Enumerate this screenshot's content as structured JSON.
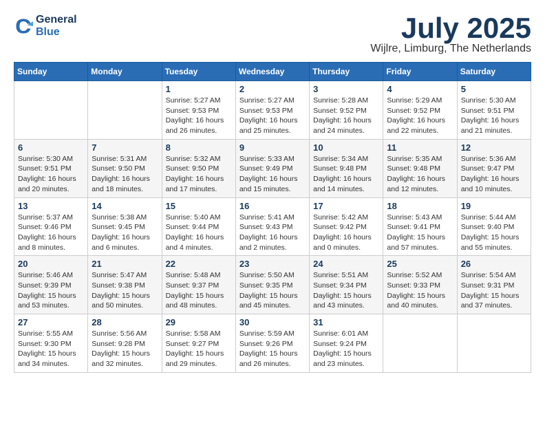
{
  "logo": {
    "line1": "General",
    "line2": "Blue"
  },
  "title": "July 2025",
  "location": "Wijlre, Limburg, The Netherlands",
  "weekdays": [
    "Sunday",
    "Monday",
    "Tuesday",
    "Wednesday",
    "Thursday",
    "Friday",
    "Saturday"
  ],
  "weeks": [
    [
      {
        "day": "",
        "text": ""
      },
      {
        "day": "",
        "text": ""
      },
      {
        "day": "1",
        "text": "Sunrise: 5:27 AM\nSunset: 9:53 PM\nDaylight: 16 hours and 26 minutes."
      },
      {
        "day": "2",
        "text": "Sunrise: 5:27 AM\nSunset: 9:53 PM\nDaylight: 16 hours and 25 minutes."
      },
      {
        "day": "3",
        "text": "Sunrise: 5:28 AM\nSunset: 9:52 PM\nDaylight: 16 hours and 24 minutes."
      },
      {
        "day": "4",
        "text": "Sunrise: 5:29 AM\nSunset: 9:52 PM\nDaylight: 16 hours and 22 minutes."
      },
      {
        "day": "5",
        "text": "Sunrise: 5:30 AM\nSunset: 9:51 PM\nDaylight: 16 hours and 21 minutes."
      }
    ],
    [
      {
        "day": "6",
        "text": "Sunrise: 5:30 AM\nSunset: 9:51 PM\nDaylight: 16 hours and 20 minutes."
      },
      {
        "day": "7",
        "text": "Sunrise: 5:31 AM\nSunset: 9:50 PM\nDaylight: 16 hours and 18 minutes."
      },
      {
        "day": "8",
        "text": "Sunrise: 5:32 AM\nSunset: 9:50 PM\nDaylight: 16 hours and 17 minutes."
      },
      {
        "day": "9",
        "text": "Sunrise: 5:33 AM\nSunset: 9:49 PM\nDaylight: 16 hours and 15 minutes."
      },
      {
        "day": "10",
        "text": "Sunrise: 5:34 AM\nSunset: 9:48 PM\nDaylight: 16 hours and 14 minutes."
      },
      {
        "day": "11",
        "text": "Sunrise: 5:35 AM\nSunset: 9:48 PM\nDaylight: 16 hours and 12 minutes."
      },
      {
        "day": "12",
        "text": "Sunrise: 5:36 AM\nSunset: 9:47 PM\nDaylight: 16 hours and 10 minutes."
      }
    ],
    [
      {
        "day": "13",
        "text": "Sunrise: 5:37 AM\nSunset: 9:46 PM\nDaylight: 16 hours and 8 minutes."
      },
      {
        "day": "14",
        "text": "Sunrise: 5:38 AM\nSunset: 9:45 PM\nDaylight: 16 hours and 6 minutes."
      },
      {
        "day": "15",
        "text": "Sunrise: 5:40 AM\nSunset: 9:44 PM\nDaylight: 16 hours and 4 minutes."
      },
      {
        "day": "16",
        "text": "Sunrise: 5:41 AM\nSunset: 9:43 PM\nDaylight: 16 hours and 2 minutes."
      },
      {
        "day": "17",
        "text": "Sunrise: 5:42 AM\nSunset: 9:42 PM\nDaylight: 16 hours and 0 minutes."
      },
      {
        "day": "18",
        "text": "Sunrise: 5:43 AM\nSunset: 9:41 PM\nDaylight: 15 hours and 57 minutes."
      },
      {
        "day": "19",
        "text": "Sunrise: 5:44 AM\nSunset: 9:40 PM\nDaylight: 15 hours and 55 minutes."
      }
    ],
    [
      {
        "day": "20",
        "text": "Sunrise: 5:46 AM\nSunset: 9:39 PM\nDaylight: 15 hours and 53 minutes."
      },
      {
        "day": "21",
        "text": "Sunrise: 5:47 AM\nSunset: 9:38 PM\nDaylight: 15 hours and 50 minutes."
      },
      {
        "day": "22",
        "text": "Sunrise: 5:48 AM\nSunset: 9:37 PM\nDaylight: 15 hours and 48 minutes."
      },
      {
        "day": "23",
        "text": "Sunrise: 5:50 AM\nSunset: 9:35 PM\nDaylight: 15 hours and 45 minutes."
      },
      {
        "day": "24",
        "text": "Sunrise: 5:51 AM\nSunset: 9:34 PM\nDaylight: 15 hours and 43 minutes."
      },
      {
        "day": "25",
        "text": "Sunrise: 5:52 AM\nSunset: 9:33 PM\nDaylight: 15 hours and 40 minutes."
      },
      {
        "day": "26",
        "text": "Sunrise: 5:54 AM\nSunset: 9:31 PM\nDaylight: 15 hours and 37 minutes."
      }
    ],
    [
      {
        "day": "27",
        "text": "Sunrise: 5:55 AM\nSunset: 9:30 PM\nDaylight: 15 hours and 34 minutes."
      },
      {
        "day": "28",
        "text": "Sunrise: 5:56 AM\nSunset: 9:28 PM\nDaylight: 15 hours and 32 minutes."
      },
      {
        "day": "29",
        "text": "Sunrise: 5:58 AM\nSunset: 9:27 PM\nDaylight: 15 hours and 29 minutes."
      },
      {
        "day": "30",
        "text": "Sunrise: 5:59 AM\nSunset: 9:26 PM\nDaylight: 15 hours and 26 minutes."
      },
      {
        "day": "31",
        "text": "Sunrise: 6:01 AM\nSunset: 9:24 PM\nDaylight: 15 hours and 23 minutes."
      },
      {
        "day": "",
        "text": ""
      },
      {
        "day": "",
        "text": ""
      }
    ]
  ]
}
